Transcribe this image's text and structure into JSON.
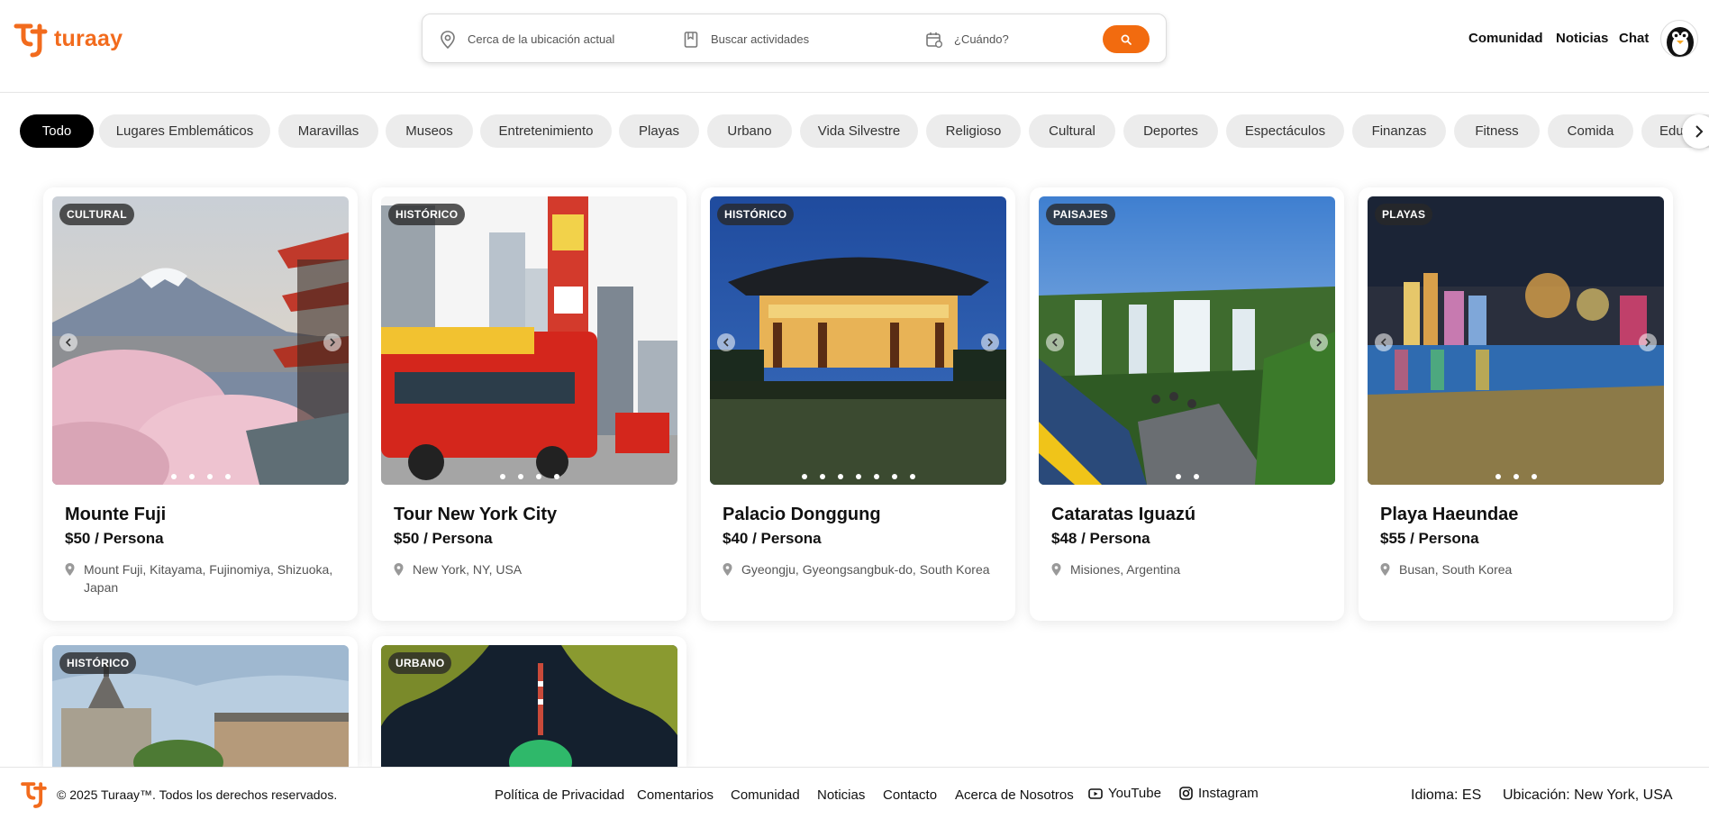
{
  "brand": {
    "name": "turaay",
    "color": "#f26b1d"
  },
  "search": {
    "location_placeholder": "Cerca de la ubicación actual",
    "activity_placeholder": "Buscar actividades",
    "date_placeholder": "¿Cuándo?",
    "icons": [
      "location-pin-icon",
      "bookmark-icon",
      "calendar-icon",
      "search-icon"
    ]
  },
  "nav": {
    "community": "Comunidad",
    "news": "Noticias",
    "chat": "Chat"
  },
  "categories": [
    "Todo",
    "Lugares Emblemáticos",
    "Maravillas",
    "Museos",
    "Entretenimiento",
    "Playas",
    "Urbano",
    "Vida Silvestre",
    "Religioso",
    "Cultural",
    "Deportes",
    "Espectáculos",
    "Finanzas",
    "Fitness",
    "Comida",
    "Educa"
  ],
  "active_category": "Todo",
  "cards": [
    {
      "badge": "CULTURAL",
      "title": "Mounte Fuji",
      "price": "$50 / Persona",
      "location": "Mount Fuji, Kitayama, Fujinomiya, Shizuoka, Japan",
      "dots": 4
    },
    {
      "badge": "HISTÓRICO",
      "title": "Tour New York City",
      "price": "$50 / Persona",
      "location": "New York, NY, USA",
      "dots": 4
    },
    {
      "badge": "HISTÓRICO",
      "title": "Palacio Donggung",
      "price": "$40 / Persona",
      "location": "Gyeongju, Gyeongsangbuk-do, South Korea",
      "dots": 7
    },
    {
      "badge": "PAISAJES",
      "title": "Cataratas Iguazú",
      "price": "$48 / Persona",
      "location": "Misiones, Argentina",
      "dots": 2
    },
    {
      "badge": "PLAYAS",
      "title": "Playa Haeundae",
      "price": "$55 / Persona",
      "location": "Busan, South Korea",
      "dots": 3
    },
    {
      "badge": "HISTÓRICO"
    },
    {
      "badge": "URBANO"
    }
  ],
  "footer": {
    "copyright": "© 2025 Turaay™. Todos los derechos reservados.",
    "links": [
      "Política de Privacidad",
      "Comentarios",
      "Comunidad",
      "Noticias",
      "Contacto",
      "Acerca de Nosotros"
    ],
    "youtube": "YouTube",
    "instagram": "Instagram",
    "language": "Idioma: ES",
    "location": "Ubicación: New York, USA"
  }
}
